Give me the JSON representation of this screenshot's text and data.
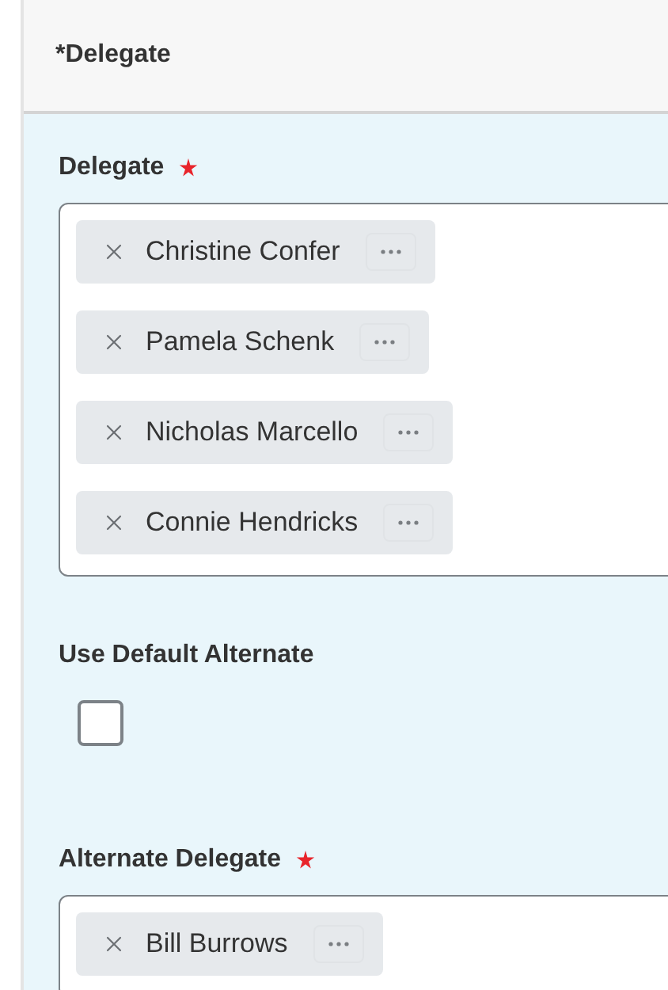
{
  "header": {
    "title": "*Delegate"
  },
  "fields": [
    {
      "kind": "multi",
      "label": "Delegate",
      "required": true,
      "items": [
        "Christine Confer",
        "Pamela Schenk",
        "Nicholas Marcello",
        "Connie Hendricks"
      ]
    },
    {
      "kind": "checkbox",
      "label": "Use Default Alternate",
      "required": false,
      "checked": false
    },
    {
      "kind": "multi",
      "label": "Alternate Delegate",
      "required": true,
      "items": [
        "Bill Burrows"
      ]
    }
  ]
}
